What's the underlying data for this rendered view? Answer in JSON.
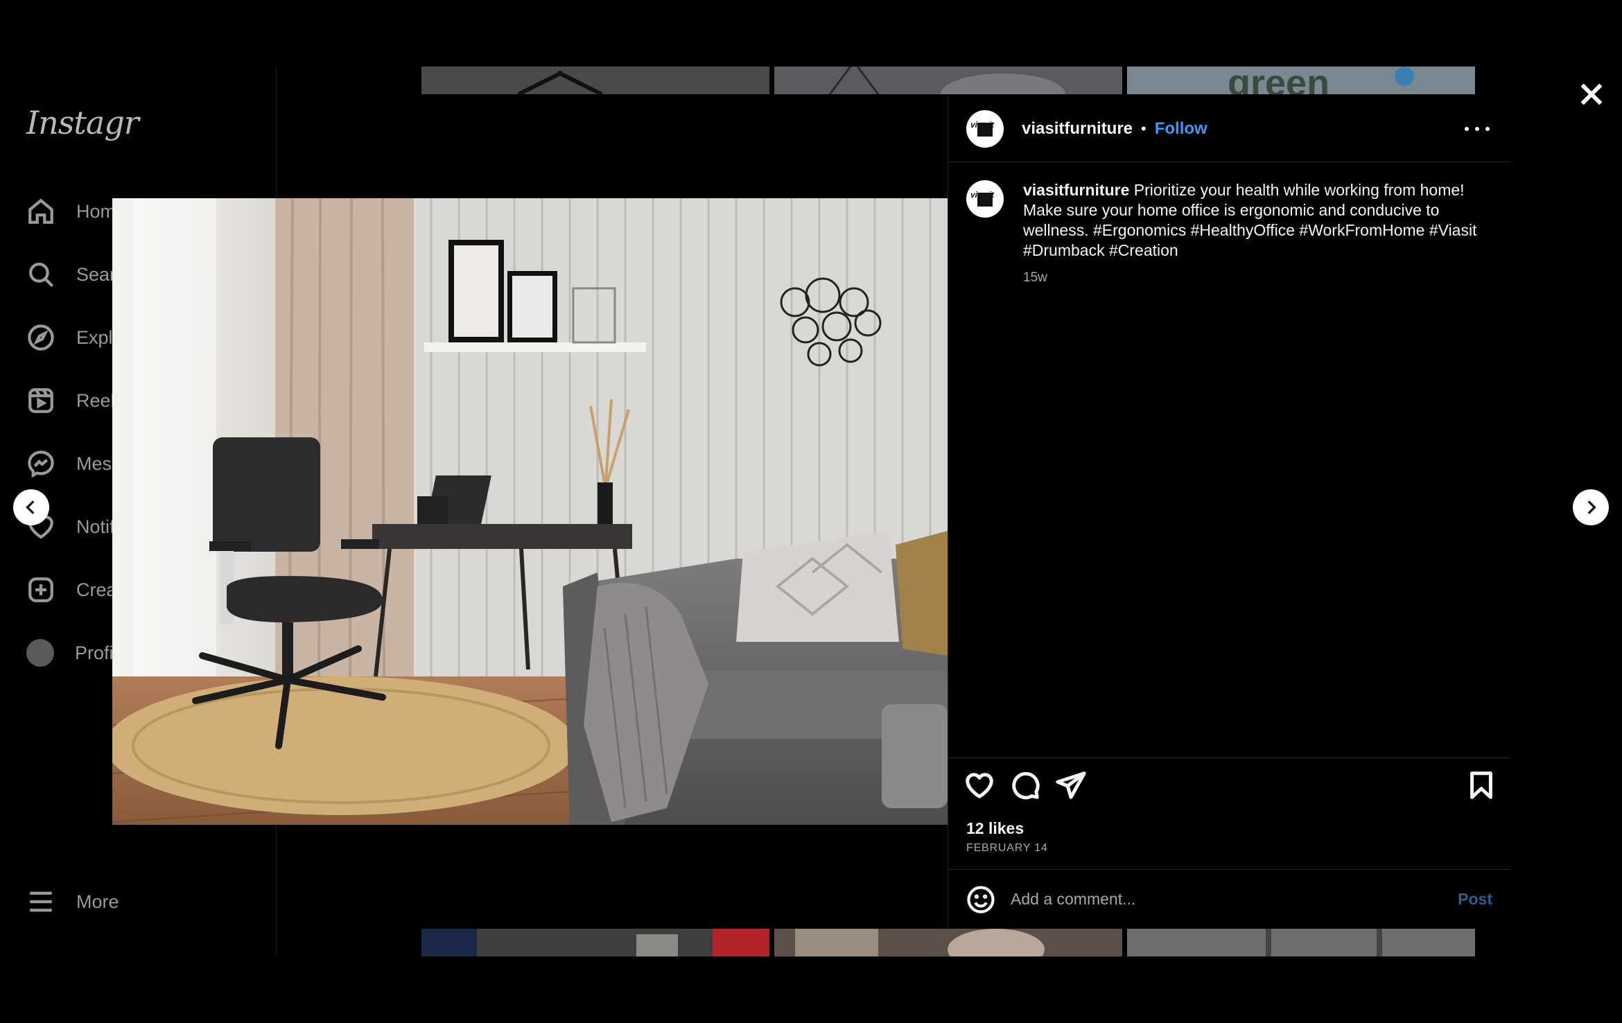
{
  "window": {
    "brand": "Instagram"
  },
  "sidebar": {
    "logo": "Instagr",
    "items": [
      {
        "label": "Hom",
        "icon": "home-icon"
      },
      {
        "label": "Searc",
        "icon": "search-icon"
      },
      {
        "label": "Explo",
        "icon": "compass-icon"
      },
      {
        "label": "Reels",
        "icon": "reels-icon"
      },
      {
        "label": "Mess",
        "icon": "messenger-icon"
      },
      {
        "label": "Notif",
        "icon": "heart-icon"
      },
      {
        "label": "Creat",
        "icon": "plus-square-icon"
      },
      {
        "label": "Profi",
        "icon": "avatar-icon"
      }
    ],
    "more_label": "More"
  },
  "post": {
    "username": "viasitfurniture",
    "avatar_text": "via sit",
    "separator": "•",
    "follow_label": "Follow",
    "caption": {
      "username": "viasitfurniture",
      "text": "Prioritize your health while working from home! Make sure your home office is ergonomic and conducive to wellness. #Ergonomics #HealthyOffice #WorkFromHome #Viasit #Drumback #Creation",
      "age": "15w"
    },
    "likes": "12 likes",
    "date": "FEBRUARY 14",
    "comment": {
      "placeholder": "Add a comment...",
      "value": "",
      "post_label": "Post"
    }
  },
  "colors": {
    "accent": "#3b9af2",
    "post_disabled": "#2b5f8f",
    "background": "#000000",
    "divider": "#262626"
  }
}
